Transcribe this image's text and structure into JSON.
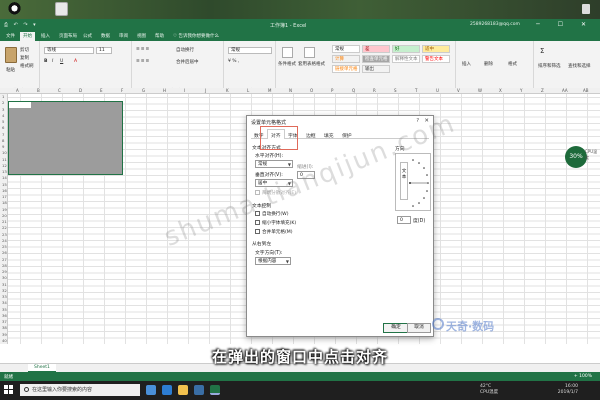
{
  "app": {
    "window_title": "工作簿1 - Excel",
    "account": "2589268183@qq.com",
    "quick_access": "⎙ ↶ ↷ ▾",
    "window_buttons": "─ ☐ ✕"
  },
  "ribbon_tabs": [
    "文件",
    "开始",
    "插入",
    "页面布局",
    "公式",
    "数据",
    "审阅",
    "视图",
    "帮助",
    "♡ 告诉我你想要做什么"
  ],
  "ribbon": {
    "clipboard": {
      "paste": "粘贴",
      "cut": "剪切",
      "copy": "复制",
      "format_painter": "格式刷",
      "label": "剪贴板"
    },
    "font": {
      "name": "等线",
      "size": "11",
      "label": "字体"
    },
    "alignment": {
      "wrap": "自动换行",
      "merge": "合并后居中",
      "label": "对齐方式"
    },
    "number": {
      "format": "常规",
      "label": "数字"
    },
    "styles": {
      "cond_format": "条件格式",
      "table_format": "套用表格格式",
      "swatches": [
        {
          "text": "常规",
          "bg": "#ffffff",
          "fg": "#222222"
        },
        {
          "text": "差",
          "bg": "#ffc7ce",
          "fg": "#9c0006"
        },
        {
          "text": "好",
          "bg": "#c6efce",
          "fg": "#006100"
        },
        {
          "text": "适中",
          "bg": "#ffeb9c",
          "fg": "#9c5700"
        },
        {
          "text": "计算",
          "bg": "#f2f2f2",
          "fg": "#fa7d00"
        },
        {
          "text": "检查单元格",
          "bg": "#a5a5a5",
          "fg": "#ffffff"
        },
        {
          "text": "解释性文本",
          "bg": "#ffffff",
          "fg": "#7f7f7f"
        },
        {
          "text": "警告文本",
          "bg": "#ffffff",
          "fg": "#ff0000"
        },
        {
          "text": "链接单元格",
          "bg": "#ffffff",
          "fg": "#fa7d00"
        },
        {
          "text": "输出",
          "bg": "#f2f2f2",
          "fg": "#3f3f3f"
        }
      ],
      "label": "样式"
    },
    "cells": {
      "insert": "插入",
      "delete": "删除",
      "format": "格式",
      "label": "单元格"
    },
    "editing": {
      "sort": "排序和筛选",
      "find": "查找和选择",
      "label": "编辑"
    }
  },
  "formula_bar": {
    "name_box": "A1",
    "fx": "fx",
    "value": ""
  },
  "columns": [
    "A",
    "B",
    "C",
    "D",
    "E",
    "F",
    "G",
    "H",
    "I",
    "J",
    "K",
    "L",
    "M",
    "N",
    "O",
    "P",
    "Q",
    "R",
    "S",
    "T",
    "U",
    "V",
    "W",
    "X",
    "Y",
    "Z",
    "AA",
    "AB"
  ],
  "rows": [
    "1",
    "2",
    "3",
    "4",
    "5",
    "6",
    "7",
    "8",
    "9",
    "10",
    "11",
    "12",
    "13",
    "14",
    "15",
    "16",
    "17",
    "18",
    "19",
    "20",
    "21",
    "22",
    "23",
    "24",
    "25",
    "26",
    "27",
    "28",
    "29",
    "30",
    "31",
    "32",
    "33",
    "34",
    "35",
    "36",
    "37",
    "38",
    "39",
    "40"
  ],
  "sheet_tab": "Sheet1",
  "status": {
    "ready": "就绪",
    "zoom": "+ 100%"
  },
  "dialog": {
    "title": "设置单元格格式",
    "help": "?",
    "close": "✕",
    "tabs": [
      "数字",
      "对齐",
      "字体",
      "边框",
      "填充",
      "保护"
    ],
    "active_tab": "对齐",
    "text_alignment_label": "文本对齐方式",
    "horizontal_label": "水平对齐(H):",
    "horizontal_value": "常规",
    "indent_label": "缩进(I):",
    "indent_value": "0",
    "vertical_label": "垂直对齐(V):",
    "vertical_value": "居中",
    "justify_distributed": "两端分散对齐(E)",
    "text_control_label": "文本控制",
    "wrap_text": "自动换行(W)",
    "shrink_to_fit": "缩小字体填充(K)",
    "merge_cells": "合并单元格(M)",
    "rtl_label": "从右到左",
    "text_direction_label": "文字方向(T):",
    "text_direction_value": "根据内容",
    "orientation_label": "方向",
    "orientation_text": "文本",
    "degrees_value": "0",
    "degrees_label": "度(D)",
    "ok": "确定",
    "cancel": "取消"
  },
  "overlay": {
    "subtitle": "在弹出的窗口中点击对齐",
    "watermark": "shuma.tianqijun.com",
    "brand": "天奇·数码",
    "cpu_percent": "30%",
    "cpu_label": "CPU温度"
  },
  "taskbar": {
    "search_placeholder": "在这里输入你要搜索的内容",
    "temperature": "42°C",
    "cpu_temp_label": "CPU温度",
    "time": "16:00",
    "date": "2019/1/7"
  }
}
